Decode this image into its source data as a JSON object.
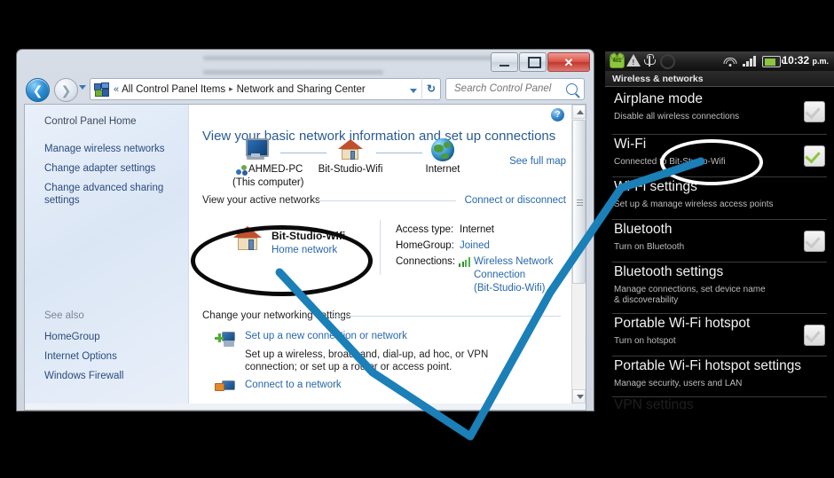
{
  "window": {
    "controls": {
      "minimize": "–",
      "maximize": "❐",
      "close": "✕"
    },
    "address": {
      "chevron": "«",
      "crumb1": "All Control Panel Items",
      "separator": "▸",
      "crumb2": "Network and Sharing Center",
      "refresh_label": "↻",
      "search_placeholder": "Search Control Panel",
      "search_value": ""
    },
    "sidebar": {
      "home": "Control Panel Home",
      "items": [
        "Manage wireless networks",
        "Change adapter settings",
        "Change advanced sharing settings"
      ],
      "see_also_label": "See also",
      "see_also": [
        "HomeGroup",
        "Internet Options",
        "Windows Firewall"
      ]
    },
    "pane": {
      "help_label": "?",
      "heading": "View your basic network information and set up connections",
      "see_full_map": "See full map",
      "map": {
        "computer": "AHMED-PC",
        "computer_sub": "(This computer)",
        "network": "Bit-Studio-Wifi",
        "internet": "Internet"
      },
      "active_section": {
        "title": "View your active networks",
        "action": "Connect or disconnect",
        "network_name": "Bit-Studio-Wifi",
        "network_type": "Home network",
        "details": [
          {
            "key": "Access type:",
            "value": "Internet",
            "link": false
          },
          {
            "key": "HomeGroup:",
            "value": "Joined",
            "link": true
          },
          {
            "key": "Connections:",
            "value": "Wireless Network",
            "link": true
          }
        ],
        "connection_line2": "Connection",
        "connection_line3": "(Bit-Studio-Wifi)"
      },
      "settings_section": {
        "title": "Change your networking settings",
        "link1": "Set up a new connection or network",
        "desc1": "Set up a wireless, broadband, dial-up, ad hoc, or VPN connection; or set up a router or access point.",
        "link2": "Connect to a network"
      }
    }
  },
  "android": {
    "status": {
      "alarm_count": "401",
      "warning_glyph": "!",
      "time": "10:32",
      "meridiem": "p.m."
    },
    "title": "Wireless & networks",
    "rows": [
      {
        "title": "Airplane mode",
        "sub": "Disable all wireless connections",
        "toggle": "off"
      },
      {
        "title": "Wi-Fi",
        "sub": "Connected to Bit-Studio-Wifi",
        "toggle": "on"
      },
      {
        "title": "Wi-Fi settings",
        "sub": "Set up & manage wireless access points",
        "toggle": "none"
      },
      {
        "title": "Bluetooth",
        "sub": "Turn on Bluetooth",
        "toggle": "off"
      },
      {
        "title": "Bluetooth settings",
        "sub": "Manage connections, set device name & discoverability",
        "toggle": "none"
      },
      {
        "title": "Portable Wi-Fi hotspot",
        "sub": "Turn on hotspot",
        "toggle": "off"
      },
      {
        "title": "Portable Wi-Fi hotspot settings",
        "sub": "Manage security, users and LAN",
        "toggle": "none"
      },
      {
        "title": "VPN settings",
        "sub": "",
        "toggle": "none"
      }
    ]
  },
  "annotations": {
    "arrow_color": "#1b7fb8",
    "windows_ellipse_color": "#0a0a0a",
    "android_ellipse_color": "#ffffff"
  }
}
